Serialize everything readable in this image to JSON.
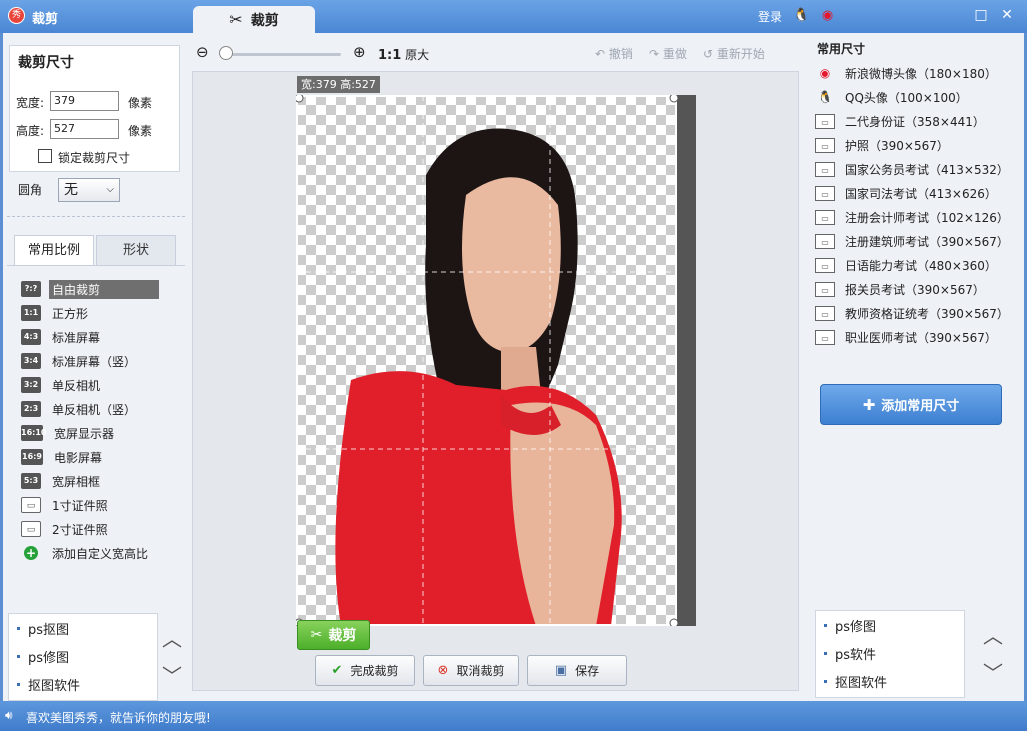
{
  "titlebar": {
    "app_title": "裁剪",
    "logo_text": "秀",
    "tab_label": "裁剪",
    "login_label": "登录",
    "qq_icon": "qq-icon",
    "weibo_icon": "weibo-icon",
    "maximize_icon": "maximize-icon",
    "close_icon": "close-icon"
  },
  "size_panel": {
    "title": "裁剪尺寸",
    "width_label": "宽度:",
    "width_value": "379",
    "height_label": "高度:",
    "height_value": "527",
    "unit": "像素",
    "lock_label": "锁定裁剪尺寸",
    "lock_checked": false,
    "corner_label": "圆角",
    "corner_value": "无"
  },
  "ratio_tabs": {
    "active": "常用比例",
    "inactive": "形状"
  },
  "ratios": [
    {
      "icon": "?:?",
      "label": "自由裁剪",
      "selected": true
    },
    {
      "icon": "1:1",
      "label": "正方形"
    },
    {
      "icon": "4:3",
      "label": "标准屏幕"
    },
    {
      "icon": "3:4",
      "label": "标准屏幕（竖）"
    },
    {
      "icon": "3:2",
      "label": "单反相机"
    },
    {
      "icon": "2:3",
      "label": "单反相机（竖）"
    },
    {
      "icon": "16:10",
      "label": "宽屏显示器"
    },
    {
      "icon": "16:9",
      "label": "电影屏幕"
    },
    {
      "icon": "5:3",
      "label": "宽屏相框"
    },
    {
      "icon": "id-card-icon",
      "label": "1寸证件照"
    },
    {
      "icon": "id-card-icon",
      "label": "2寸证件照"
    },
    {
      "icon": "+",
      "label": "添加自定义宽高比"
    }
  ],
  "left_links": [
    "ps抠图",
    "ps修图",
    "抠图软件"
  ],
  "toolbar": {
    "zoom_ratio": "1:1",
    "orig_label": "原大",
    "undo_label": "撤销",
    "redo_label": "重做",
    "restart_label": "重新开始",
    "zoom_level": 0.0
  },
  "canvas": {
    "crop_tag": "宽:379 高:527",
    "crop_button": "裁剪",
    "finish_button": "完成裁剪",
    "cancel_button": "取消裁剪",
    "save_button": "保存"
  },
  "presets": {
    "title": "常用尺寸",
    "items": [
      {
        "icon": "weibo-icon",
        "label": "新浪微博头像（180×180）"
      },
      {
        "icon": "qq-icon",
        "label": "QQ头像（100×100）"
      },
      {
        "icon": "id-card-icon",
        "label": "二代身份证（358×441）"
      },
      {
        "icon": "id-card-icon",
        "label": "护照（390×567）"
      },
      {
        "icon": "id-card-icon",
        "label": "国家公务员考试（413×532）"
      },
      {
        "icon": "id-card-icon",
        "label": "国家司法考试（413×626）"
      },
      {
        "icon": "id-card-icon",
        "label": "注册会计师考试（102×126）"
      },
      {
        "icon": "id-card-icon",
        "label": "注册建筑师考试（390×567）"
      },
      {
        "icon": "id-card-icon",
        "label": "日语能力考试（480×360）"
      },
      {
        "icon": "id-card-icon",
        "label": "报关员考试（390×567）"
      },
      {
        "icon": "id-card-icon",
        "label": "教师资格证统考（390×567）"
      },
      {
        "icon": "id-card-icon",
        "label": "职业医师考试（390×567）"
      }
    ],
    "add_button": "添加常用尺寸"
  },
  "right_links": [
    "ps修图",
    "ps软件",
    "抠图软件"
  ],
  "statusbar": {
    "message": "喜欢美图秀秀，就告诉你的朋友哦!"
  },
  "colors": {
    "titlebar": "#4a86d3",
    "accent_green": "#4caf2a",
    "add_button": "#3d7fd1",
    "selected_ratio": "#6f6f6f"
  }
}
